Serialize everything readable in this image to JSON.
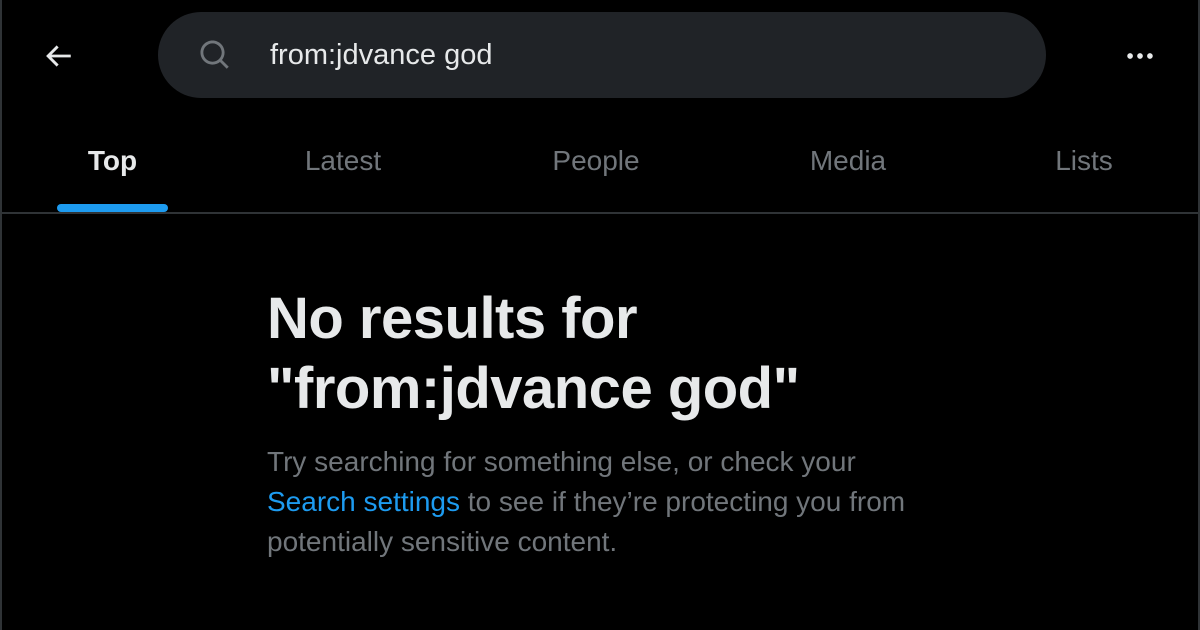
{
  "header": {
    "back_icon": "arrow-left-icon",
    "search": {
      "icon": "search-icon",
      "value": "from:jdvance god"
    },
    "more_icon": "more-horizontal-icon"
  },
  "tabs": [
    {
      "label": "Top",
      "active": true
    },
    {
      "label": "Latest",
      "active": false
    },
    {
      "label": "People",
      "active": false
    },
    {
      "label": "Media",
      "active": false
    },
    {
      "label": "Lists",
      "active": false
    }
  ],
  "empty_state": {
    "title_line1": "No results for",
    "title_line2": "\"from:jdvance god\"",
    "body_before_link": "Try searching for something else, or check your ",
    "link_text": "Search settings",
    "body_after_link": " to see if they’re protecting you from potentially sensitive content."
  },
  "colors": {
    "background": "#000000",
    "search_bg": "#202327",
    "text_primary": "#e7e9ea",
    "text_secondary": "#71767b",
    "accent": "#1d9bf0",
    "divider": "#2f3336"
  }
}
